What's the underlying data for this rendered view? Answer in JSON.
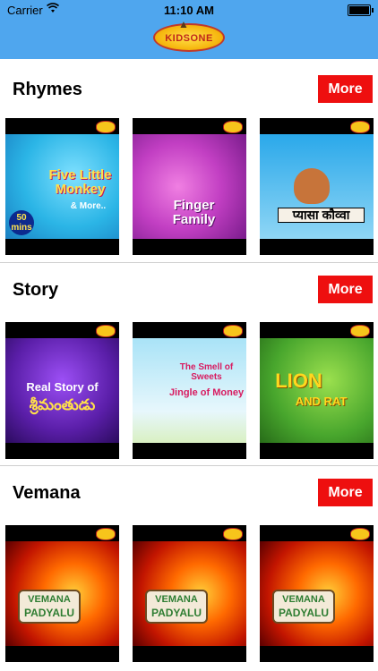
{
  "status_bar": {
    "carrier": "Carrier",
    "time": "11:10 AM"
  },
  "header": {
    "logo_text": "KIDSONE"
  },
  "colors": {
    "header_bg": "#4fa6ee",
    "more_button_bg": "#ee0f0f"
  },
  "sections": [
    {
      "title": "Rhymes",
      "more_label": "More",
      "thumbnails": [
        {
          "caption_main": "Five Little Monkey",
          "caption_sub": "& More..",
          "duration_badge": "50 mins"
        },
        {
          "caption_main": "Finger Family"
        },
        {
          "caption_main": "प्यासा कौव्वा"
        }
      ]
    },
    {
      "title": "Story",
      "more_label": "More",
      "thumbnails": [
        {
          "caption_main": "Real Story of",
          "caption_sub": "శ్రీమంతుడు"
        },
        {
          "caption_main": "The Smell of Sweets",
          "caption_sub": "Jingle of Money"
        },
        {
          "caption_main": "LION",
          "caption_sub": "AND RAT"
        }
      ]
    },
    {
      "title": "Vemana",
      "more_label": "More",
      "thumbnails": [
        {
          "caption_main": "VEMANA",
          "caption_sub": "PADYALU"
        },
        {
          "caption_main": "VEMANA",
          "caption_sub": "PADYALU"
        },
        {
          "caption_main": "VEMANA",
          "caption_sub": "PADYALU"
        }
      ]
    }
  ]
}
